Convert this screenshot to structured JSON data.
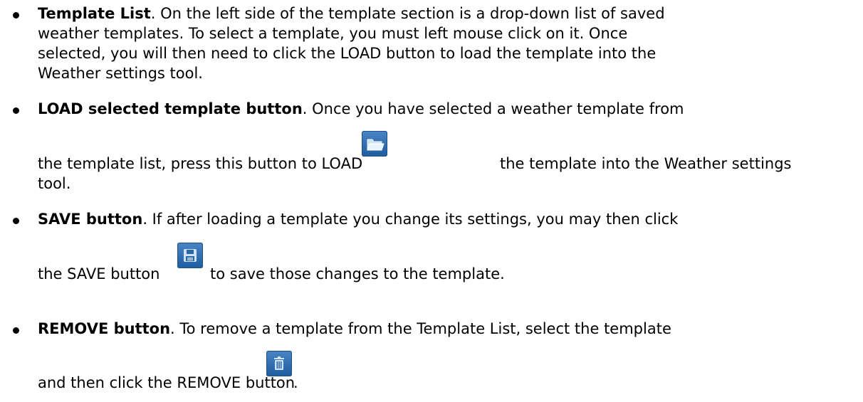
{
  "items": [
    {
      "title": "Template List",
      "lines": [
        ". On the left side of the template section is a drop-down list of saved",
        "weather templates.  To select a template, you must left mouse click on it.  Once",
        "selected, you will then need to click the LOAD button to load the template into the",
        "Weather settings tool."
      ]
    },
    {
      "title": "LOAD selected template button",
      "lines": [
        ". Once you have selected a weather template from",
        "the template list, press this button to LOAD",
        "the template into the Weather settings",
        "tool."
      ],
      "icon": "folder-icon"
    },
    {
      "title": "SAVE button",
      "lines": [
        ". If after loading a template you change its settings, you may then click",
        "the SAVE button",
        "to save those changes to the template."
      ],
      "icon": "save-icon"
    },
    {
      "title": "REMOVE button",
      "lines": [
        ". To remove a template from the Template List, select the template",
        "and then click the REMOVE button",
        "."
      ],
      "icon": "trash-icon"
    }
  ]
}
